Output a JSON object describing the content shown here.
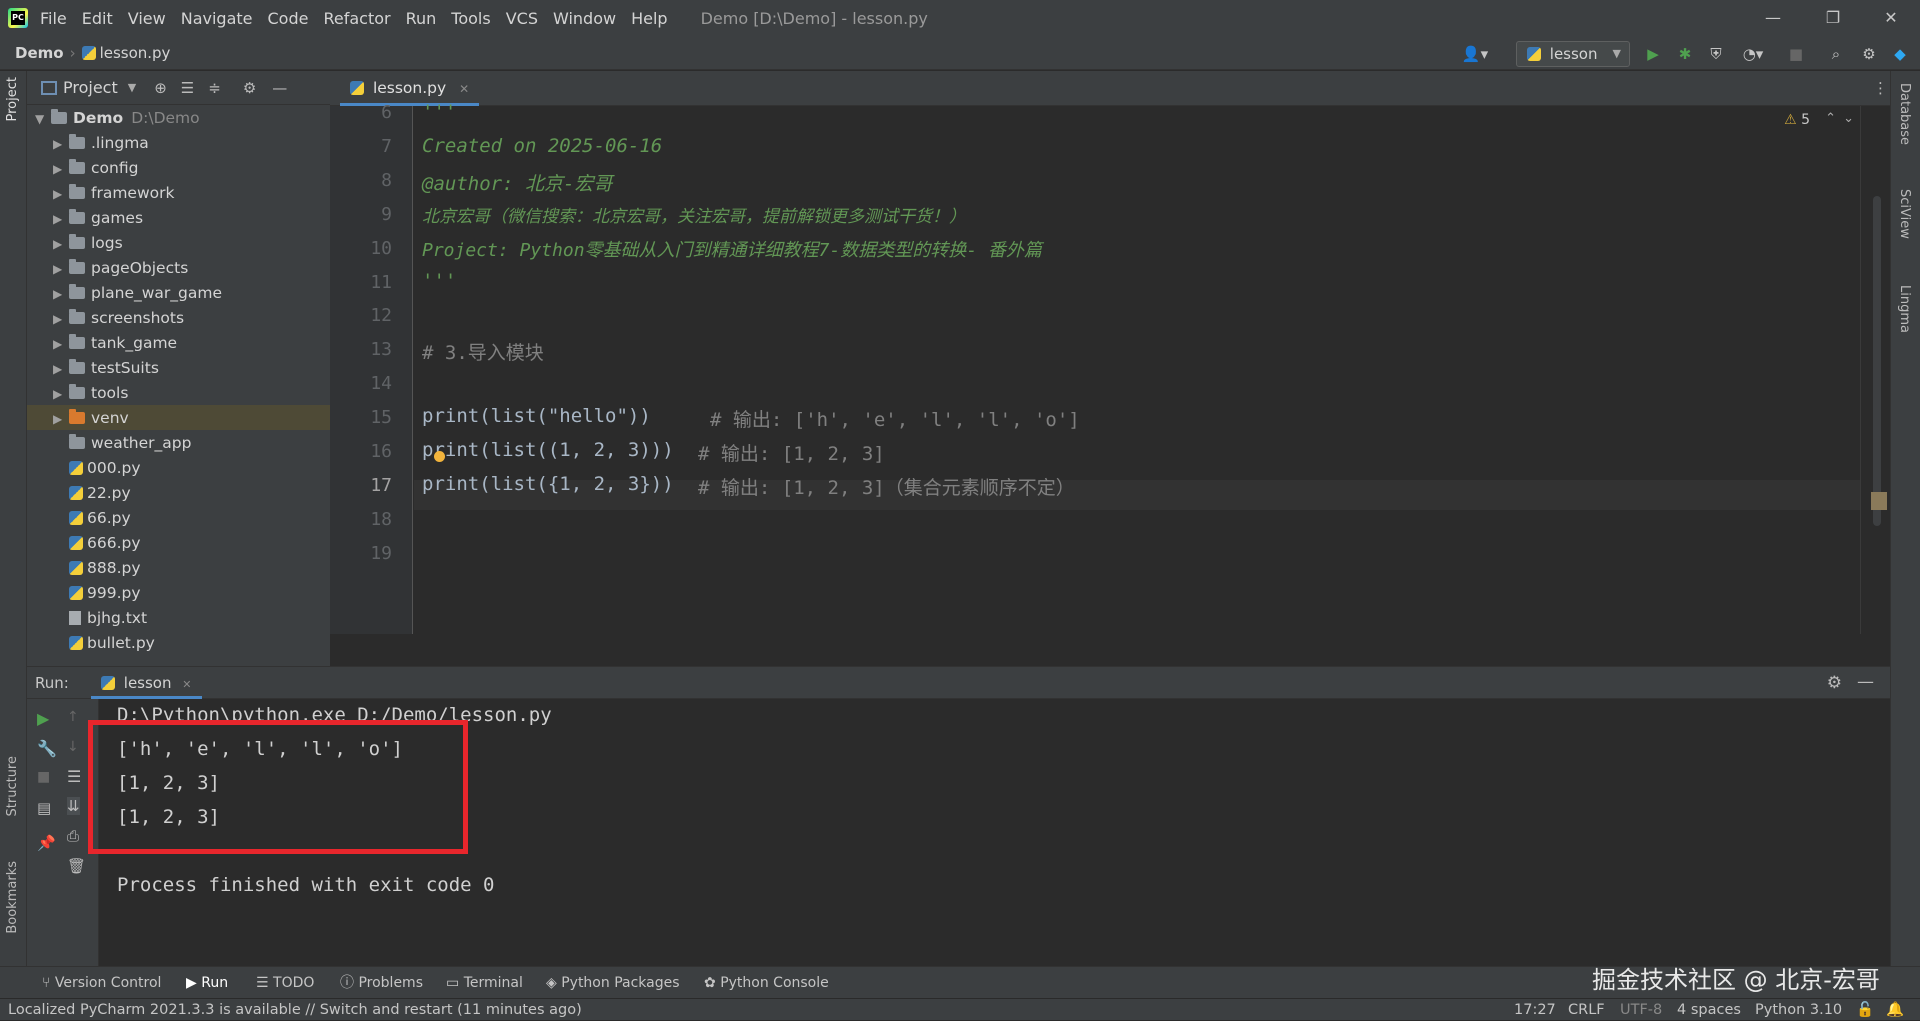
{
  "menu": [
    "File",
    "Edit",
    "View",
    "Navigate",
    "Code",
    "Refactor",
    "Run",
    "Tools",
    "VCS",
    "Window",
    "Help"
  ],
  "window_title": "Demo [D:\\Demo] - lesson.py",
  "breadcrumb": {
    "project": "Demo",
    "file": "lesson.py"
  },
  "run_config": "lesson",
  "project_panel": {
    "title": "Project",
    "root": {
      "name": "Demo",
      "path": "D:\\Demo"
    },
    "items": [
      ".lingma",
      "config",
      "framework",
      "games",
      "logs",
      "pageObjects",
      "plane_war_game",
      "screenshots",
      "tank_game",
      "testSuits",
      "tools",
      "venv",
      "weather_app",
      "000.py",
      "22.py",
      "66.py",
      "666.py",
      "888.py",
      "999.py",
      "bjhg.txt",
      "bullet.py"
    ]
  },
  "editor": {
    "tab": "lesson.py",
    "warnings": "5",
    "line_numbers": [
      "6",
      "7",
      "8",
      "9",
      "10",
      "11",
      "12",
      "13",
      "14",
      "15",
      "16",
      "17",
      "18",
      "19"
    ],
    "lines": {
      "l6": "'''",
      "l7": "Created on 2025-06-16",
      "l8": "@author: 北京-宏哥",
      "l9": "北京宏哥（微信搜索：北京宏哥，关注宏哥，提前解锁更多测试干货！）",
      "l10": "Project: Python零基础从入门到精通详细教程7-数据类型的转换- 番外篇",
      "l11": "'''",
      "l13": "# 3.导入模块",
      "l15a": "print(list(\"hello\"))",
      "l15b": "# 输出: ['h', 'e', 'l', 'l', 'o']",
      "l16a": "print(list((1, 2, 3)))",
      "l16b": "# 输出: [1, 2, 3]",
      "l17a": "print(list({1, 2, 3}))",
      "l17b": "# 输出: [1, 2, 3]（集合元素顺序不定）"
    }
  },
  "run_panel": {
    "label": "Run:",
    "tab": "lesson",
    "output": [
      "D:\\Python\\python.exe D:/Demo/lesson.py",
      "['h', 'e', 'l', 'l', 'o']",
      "[1, 2, 3]",
      "[1, 2, 3]",
      "",
      "Process finished with exit code 0"
    ]
  },
  "side_labels": {
    "project": "Project",
    "structure": "Structure",
    "bookmarks": "Bookmarks",
    "database": "Database",
    "sciview": "SciView",
    "lingma": "Lingma"
  },
  "bottom_tools": [
    "Version Control",
    "Run",
    "TODO",
    "Problems",
    "Terminal",
    "Python Packages",
    "Python Console"
  ],
  "status": {
    "message": "Localized PyCharm 2021.3.3 is available // Switch and restart (11 minutes ago)",
    "position": "17:27",
    "line_sep": "CRLF",
    "encoding": "UTF-8",
    "indent": "4 spaces",
    "interpreter": "Python 3.10"
  },
  "watermark": "掘金技术社区 @ 北京-宏哥",
  "colors": {
    "accent": "#4a88c7",
    "highlight_box": "#e8262c",
    "run_green": "#4fa04f"
  }
}
